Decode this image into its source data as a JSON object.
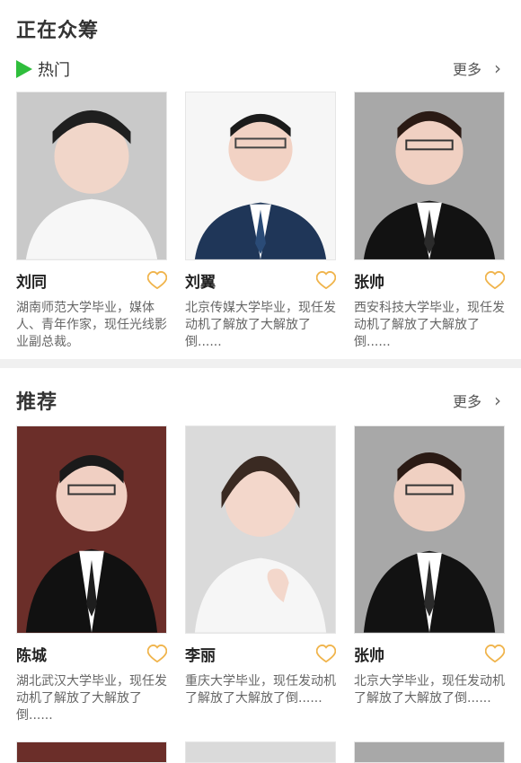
{
  "crowdfunding": {
    "title": "正在众筹",
    "hot_label": "热门",
    "more_label": "更多",
    "people": [
      {
        "name": "刘同",
        "desc": "湖南师范大学毕业，媒体人、青年作家，现任光线影业副总裁。"
      },
      {
        "name": "刘翼",
        "desc": "北京传媒大学毕业，现任发动机了解放了大解放了倒......"
      },
      {
        "name": "张帅",
        "desc": "西安科技大学毕业，现任发动机了解放了大解放了倒......"
      }
    ]
  },
  "recommend": {
    "title": "推荐",
    "more_label": "更多",
    "people": [
      {
        "name": "陈城",
        "desc": "湖北武汉大学毕业，现任发动机了解放了大解放了倒......"
      },
      {
        "name": "李丽",
        "desc": "重庆大学毕业，现任发动机了解放了大解放了倒......"
      },
      {
        "name": "张帅",
        "desc": "北京大学毕业，现任发动机了解放了大解放了倒......"
      }
    ]
  },
  "icons": {
    "play": "play-triangle-icon",
    "chevron": "chevron-right-icon",
    "heart": "heart-outline-icon"
  },
  "colors": {
    "accent_green": "#2fbe3c",
    "heart": "#f0b44c",
    "separator": "#f0f0f0"
  }
}
